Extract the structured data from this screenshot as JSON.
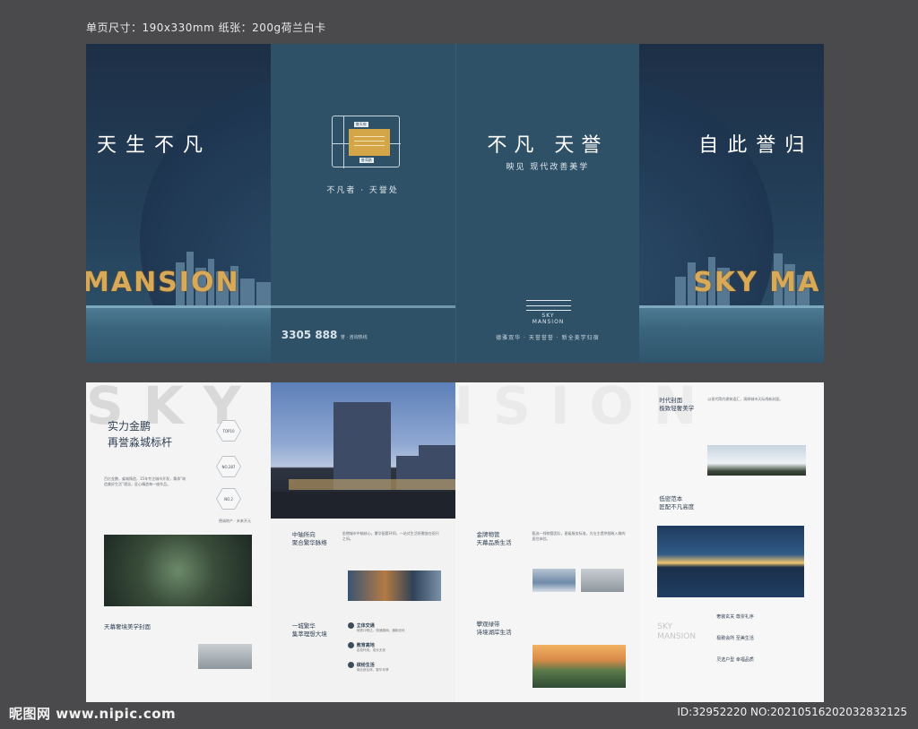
{
  "spec_text": "单页尺寸：190x330mm   纸张：200g荷兰白卡",
  "outside": {
    "panel_a": {
      "title": "天生不凡",
      "gold_word": "MANSION"
    },
    "panel_b": {
      "map_tag_top": "誉天府",
      "map_tag_bottom": "誉湾路",
      "map_block_text": "誉天府",
      "slogan": "不凡者 · 天誉处",
      "phone_number": "3305 888",
      "phone_suffix": "誉 · 咨询热线"
    },
    "panel_c": {
      "title": "不凡 天誉",
      "subtitle": "映见 现代改善美学",
      "logo_name": "SKY MANSION",
      "footer": "德雅双华 · 天誉誉誉 · 新全美学归宿"
    },
    "panel_d": {
      "title": "自此誉归",
      "gold_word": "SKY MA"
    }
  },
  "inside": {
    "watermark": "SKY MANSION",
    "panel_a": {
      "heading_1": "实力金鹏",
      "heading_2": "再誉淼城标杆",
      "hex_labels": [
        "TOP10",
        "NO.287",
        "NO.2"
      ],
      "section_title": "天幕奢境美学封面",
      "tag_text": "德诚地产 · 未来开元",
      "body": "百亿金鹏，淼城铸造，15年专注城市开发，秉承“筑造美好生活”理念，匠心精造每一座作品。"
    },
    "panel_b": {
      "block_1_title_1": "中轴所向",
      "block_1_title_2": "聚合繁华脉络",
      "block_2_title_1": "一城繁华",
      "block_2_title_2": "集萃理想大境",
      "icon_items": [
        {
          "title": "立体交通",
          "text": "地铁口畅达，快速路网，通勤无忧"
        },
        {
          "title": "教育高地",
          "text": "名校环绕，成长无忧"
        },
        {
          "title": "缤纷生活",
          "text": "商业综合体，繁华尽享"
        }
      ],
      "body": "坐拥城市中轴核心，繁华配套环伺，一站式生活所需皆在咫尺之间。"
    },
    "panel_c": {
      "block_1_title_1": "金牌物管",
      "block_1_title_2": "天幕品质生活",
      "block_2_title_1": "攀观绿带",
      "block_2_title_2": "诗境湖岸生活",
      "body": "甄选一线物管团队，星级服务标准，为业主提供细致入微的居住体验。"
    },
    "panel_d": {
      "block_1_title_1": "时代封面",
      "block_1_title_2": "极致轻奢美学",
      "block_2_title_1": "低密范本",
      "block_2_title_2": "匠配不凡高度",
      "side_text_1": "SKY",
      "side_text_2": "MANSION",
      "list": [
        "奢装玄关 尊崇礼序",
        "极致会所 至美生活",
        "灵选户型 幸福品质"
      ],
      "body": "以现代简约建筑语汇，演绎城市天际线新封面。"
    }
  },
  "watermark_left": "昵图网 www.nipic.com",
  "watermark_right": "ID:32952220 NO:20210516202032832125"
}
